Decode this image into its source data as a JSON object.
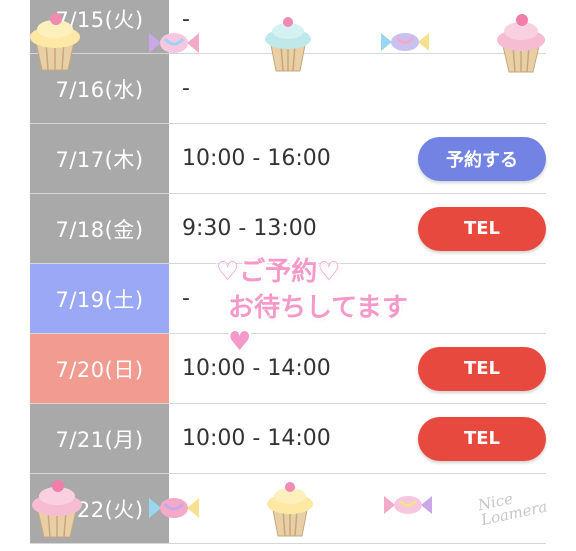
{
  "schedule": [
    {
      "date": "7/15(火)",
      "hours": "-",
      "button": ""
    },
    {
      "date": "7/16(水)",
      "hours": "-",
      "button": ""
    },
    {
      "date": "7/17(木)",
      "hours": "10:00 - 16:00",
      "button": "予約する"
    },
    {
      "date": "7/18(金)",
      "hours": "9:30 - 13:00",
      "button": "TEL"
    },
    {
      "date": "7/19(土)",
      "hours": "-",
      "button": ""
    },
    {
      "date": "7/20(日)",
      "hours": "10:00 - 14:00",
      "button": "TEL"
    },
    {
      "date": "7/21(月)",
      "hours": "10:00 - 14:00",
      "button": "TEL"
    },
    {
      "date": "7/22(火)",
      "hours": "",
      "button": ""
    }
  ],
  "stamp": {
    "line1": "♡ご予約♡",
    "line2": "お待ちしてます♥"
  },
  "watermark": {
    "line1": "Nice",
    "line2": "Loamera"
  },
  "colors": {
    "date_weekday": "#a9a9a9",
    "date_saturday": "#9aa8f5",
    "date_sunday": "#f19b91",
    "reserve_button": "#7383e3",
    "tel_button": "#e8493e",
    "stamp_pink": "#f59ac8"
  }
}
